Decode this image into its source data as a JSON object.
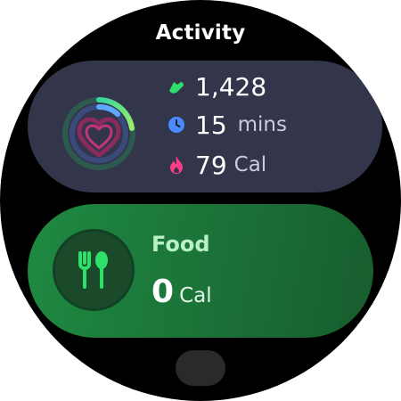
{
  "header": {
    "title": "Activity"
  },
  "activity": {
    "steps": {
      "value": "1,428",
      "icon": "shoe-icon",
      "color": "#2ee06a"
    },
    "time": {
      "value": "15",
      "unit": "mins",
      "icon": "clock-icon",
      "color": "#4a8cff"
    },
    "calories": {
      "value": "79",
      "unit": "Cal",
      "icon": "flame-icon",
      "color": "#ff3d86"
    },
    "rings_icon": "activity-rings-heart-icon"
  },
  "food": {
    "label": "Food",
    "value": "0",
    "unit": "Cal",
    "icon": "fork-spoon-icon",
    "accent": "#2ee06a"
  },
  "colors": {
    "background": "#000000",
    "activity_card": "#33364a",
    "food_card": "#1e8a42"
  }
}
